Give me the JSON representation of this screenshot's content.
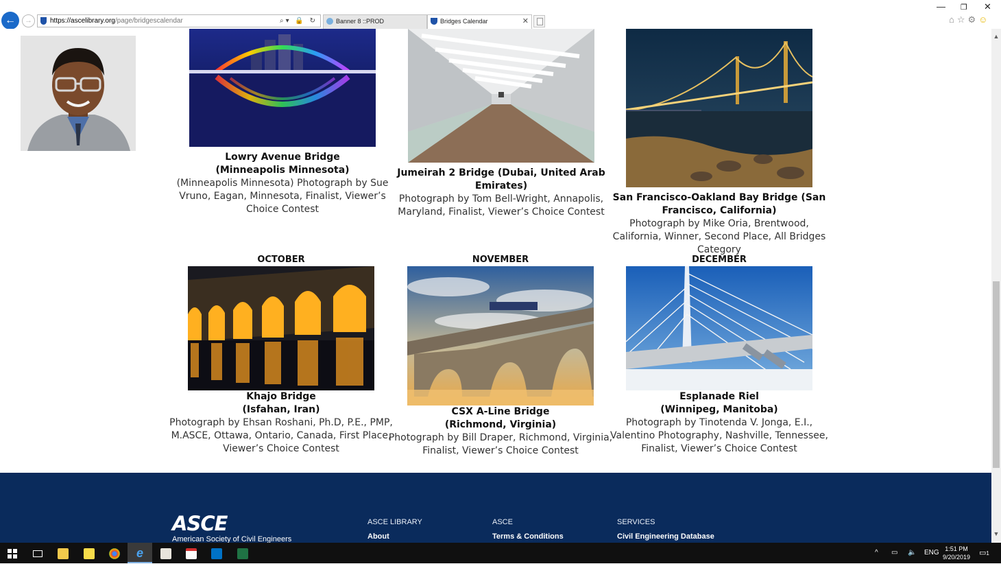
{
  "browser": {
    "url_domain": "https://ascelibrary.org",
    "url_path": "/page/bridgescalendar",
    "tabs": [
      {
        "label": "Banner 8 ::PROD"
      },
      {
        "label": "Bridges Calendar"
      }
    ],
    "window": {
      "minimize": "—",
      "restore": "❐",
      "close": "✕"
    }
  },
  "calendar": {
    "top_row": [
      {
        "title": "Lowry Avenue Bridge",
        "location": "(Minneapolis Minnesota)",
        "credit": "(Minneapolis Minnesota) Photograph by Sue Vruno, Eagan, Minnesota, Finalist, Viewer’s Choice Contest"
      },
      {
        "title": "Jumeirah 2 Bridge (Dubai, United Arab Emirates)",
        "credit": "Photograph by Tom Bell-Wright, Annapolis, Maryland, Finalist, Viewer’s Choice Contest"
      },
      {
        "title": "San Francisco-Oakland Bay Bridge (San Francisco, California)",
        "credit": "Photograph by Mike Oria, Brentwood, California, Winner, Second Place, All Bridges Category"
      }
    ],
    "bottom_row": [
      {
        "month": "OCTOBER",
        "title": "Khajo Bridge",
        "location": "(Isfahan, Iran)",
        "credit": "Photograph by Ehsan Roshani, Ph.D, P.E., PMP, M.ASCE, Ottawa, Ontario, Canada, First Place, Viewer’s Choice Contest"
      },
      {
        "month": "NOVEMBER",
        "title": "CSX A-Line Bridge",
        "location": "(Richmond, Virginia)",
        "credit": "Photograph by Bill Draper, Richmond, Virginia, Finalist, Viewer’s Choice Contest"
      },
      {
        "month": "DECEMBER",
        "title": "Esplanade Riel",
        "location": "(Winnipeg, Manitoba)",
        "credit": "Photograph by Tinotenda V. Jonga, E.I., Valentino Photography, Nashville, Tennessee, Finalist, Viewer’s Choice Contest"
      }
    ]
  },
  "footer": {
    "logo_text": "ASCE",
    "org_name": "American Society of Civil Engineers",
    "columns": [
      {
        "heading": "ASCE LIBRARY",
        "link": "About"
      },
      {
        "heading": "ASCE",
        "link": "Terms & Conditions"
      },
      {
        "heading": "SERVICES",
        "link": "Civil Engineering Database"
      }
    ]
  },
  "taskbar": {
    "language": "ENG",
    "time": "1:51 PM",
    "date": "9/20/2019",
    "notification_count": "1"
  },
  "colors": {
    "footer_bg": "#0a2b5c",
    "browser_accent": "#1b6ac9"
  }
}
